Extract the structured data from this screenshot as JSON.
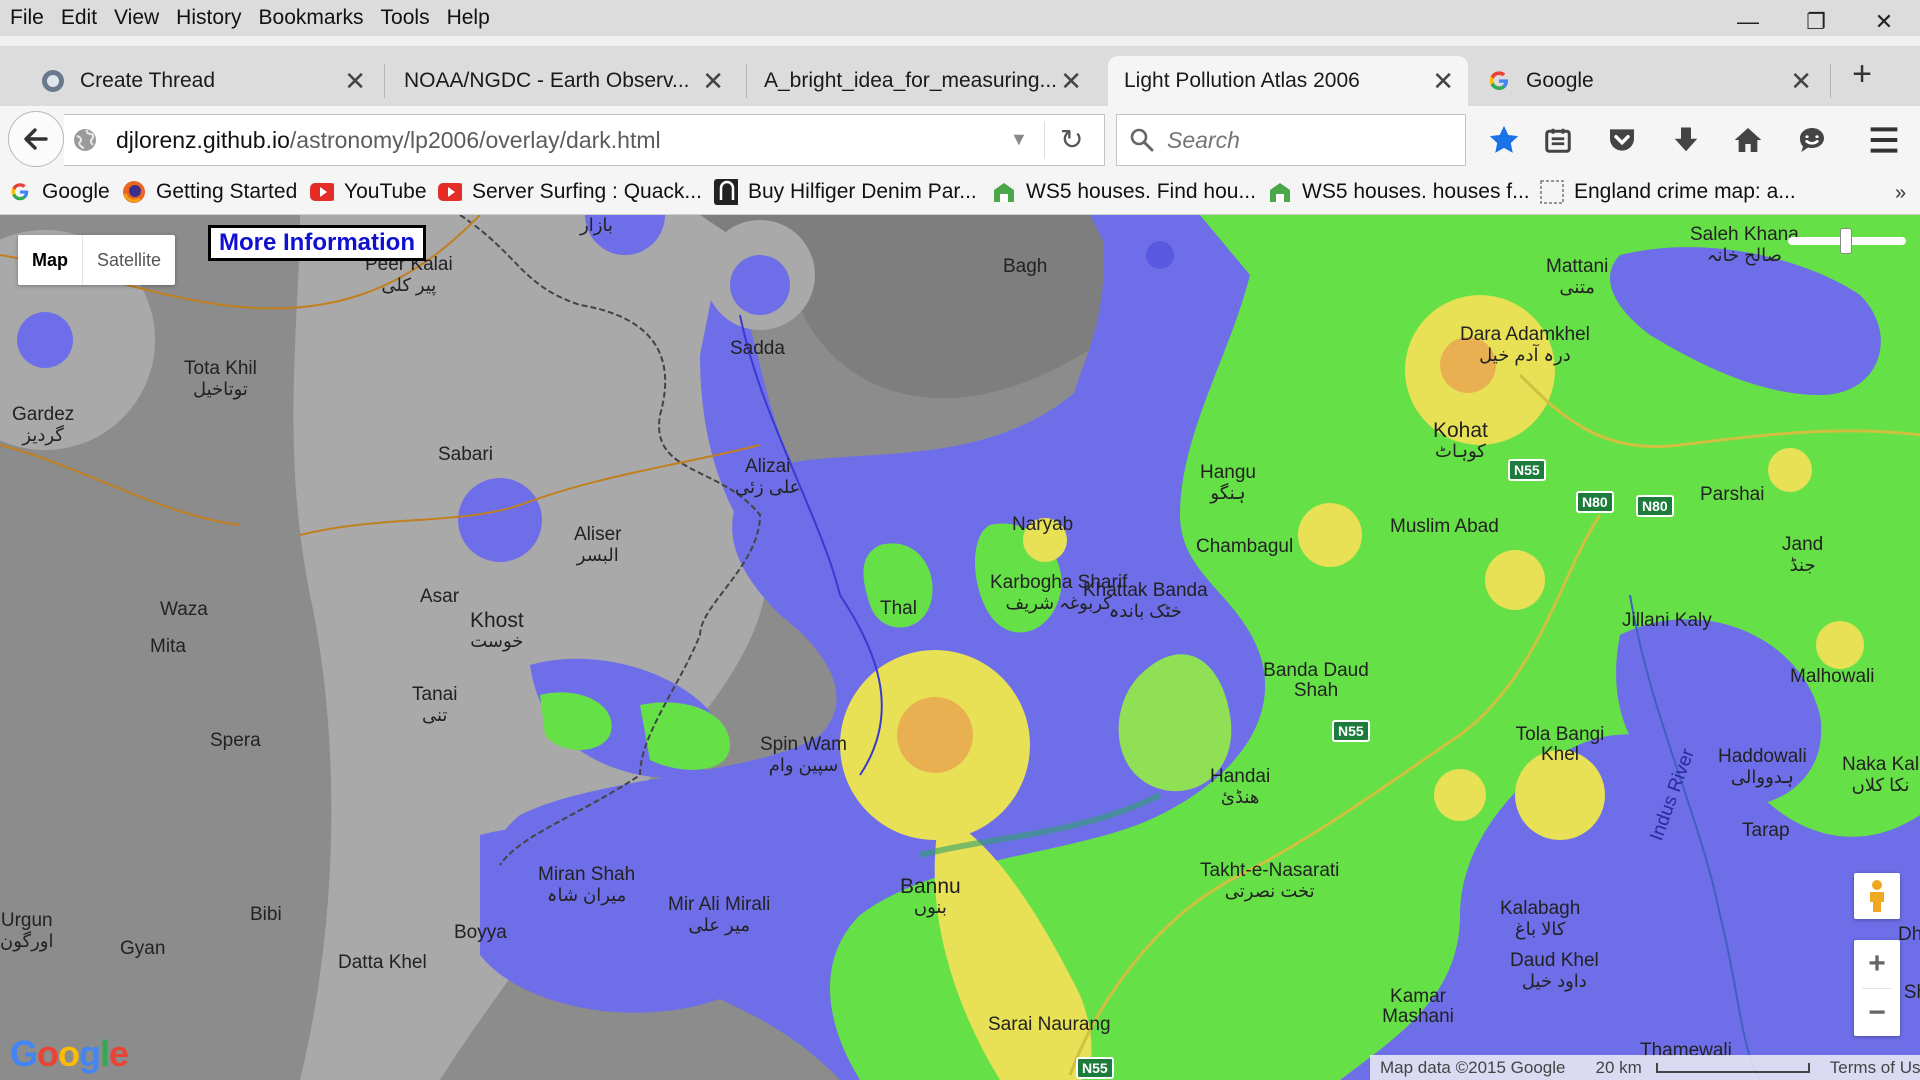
{
  "menu": [
    "File",
    "Edit",
    "View",
    "History",
    "Bookmarks",
    "Tools",
    "Help"
  ],
  "window": {
    "minimize": "—",
    "restore": "❐",
    "close": "✕"
  },
  "tabs": [
    {
      "title": "Create Thread"
    },
    {
      "title": "NOAA/NGDC - Earth Observ..."
    },
    {
      "title": "A_bright_idea_for_measuring..."
    },
    {
      "title": "Light Pollution Atlas 2006",
      "active": true
    },
    {
      "title": "Google"
    }
  ],
  "new_tab": "+",
  "nav": {
    "url_host": "djlorenz.github.io",
    "url_path": "/astronomy/lp2006/overlay/dark.html",
    "search_placeholder": "Search"
  },
  "bookmarks": [
    {
      "label": "Google"
    },
    {
      "label": "Getting Started"
    },
    {
      "label": "YouTube"
    },
    {
      "label": "Server Surfing : Quack..."
    },
    {
      "label": "Buy Hilfiger Denim Par..."
    },
    {
      "label": "WS5 houses. Find hou..."
    },
    {
      "label": "WS5 houses. houses f..."
    },
    {
      "label": "England crime map: a..."
    }
  ],
  "bookmarks_overflow": "»",
  "map": {
    "controls": {
      "map_label": "Map",
      "satellite_label": "Satellite",
      "more_info": "More Information",
      "zoom_in": "+",
      "zoom_out": "−"
    },
    "labels": [
      {
        "name": "Peer Kalai",
        "urdu": "پیر کلی"
      },
      {
        "name": "Bagh",
        "urdu": ""
      },
      {
        "name": "Sadda",
        "urdu": ""
      },
      {
        "name": "Mattani",
        "urdu": "متنی"
      },
      {
        "name": "Saleh Khana",
        "urdu": "صالح خانہ"
      },
      {
        "name": "Tota Khil",
        "urdu": "توتاخیل"
      },
      {
        "name": "Gardez",
        "urdu": "گردیز"
      },
      {
        "name": "Sabari",
        "urdu": ""
      },
      {
        "name": "Alizai",
        "urdu": "علی زئی"
      },
      {
        "name": "Dara Adamkhel",
        "urdu": "درہ آدم خیل"
      },
      {
        "name": "Kohat",
        "urdu": "کوہاٹ"
      },
      {
        "name": "Hangu",
        "urdu": "ہنگو"
      },
      {
        "name": "Parshai",
        "urdu": ""
      },
      {
        "name": "Aliser",
        "urdu": "البسر"
      },
      {
        "name": "Naryab",
        "urdu": ""
      },
      {
        "name": "Muslim Abad",
        "urdu": ""
      },
      {
        "name": "Chambagul",
        "urdu": ""
      },
      {
        "name": "Jand",
        "urdu": "جنڈ"
      },
      {
        "name": "Asar",
        "urdu": ""
      },
      {
        "name": "Khost",
        "urdu": "خوست"
      },
      {
        "name": "Karbogha Sharif",
        "urdu": "کربوغہ شریف"
      },
      {
        "name": "Khattak Banda",
        "urdu": "خٹک باندہ"
      },
      {
        "name": "Thal",
        "urdu": ""
      },
      {
        "name": "Waza",
        "urdu": ""
      },
      {
        "name": "Mita",
        "urdu": ""
      },
      {
        "name": "Jillani Kaly",
        "urdu": ""
      },
      {
        "name": "Tanai",
        "urdu": "تنی"
      },
      {
        "name": "Banda Daud Shah",
        "urdu": ""
      },
      {
        "name": "Malhowali",
        "urdu": ""
      },
      {
        "name": "Spera",
        "urdu": ""
      },
      {
        "name": "Spin Wam",
        "urdu": "سپین وام"
      },
      {
        "name": "Tola Bangi Khel",
        "urdu": ""
      },
      {
        "name": "Handai",
        "urdu": "ھنڈئ"
      },
      {
        "name": "Haddowali",
        "urdu": "ہدووالی"
      },
      {
        "name": "Naka Kal",
        "urdu": "نکا کلاں"
      },
      {
        "name": "Indus River",
        "urdu": ""
      },
      {
        "name": "Tarap",
        "urdu": ""
      },
      {
        "name": "Miran Shah",
        "urdu": "میران شاہ"
      },
      {
        "name": "Mir Ali Mirali",
        "urdu": "میر علی"
      },
      {
        "name": "Bannu",
        "urdu": "بنوں"
      },
      {
        "name": "Takht-e-Nasarati",
        "urdu": "تخت نصرتی"
      },
      {
        "name": "Kalabagh",
        "urdu": "کالا باغ"
      },
      {
        "name": "Bibi",
        "urdu": ""
      },
      {
        "name": "Boyya",
        "urdu": ""
      },
      {
        "name": "Gyan",
        "urdu": ""
      },
      {
        "name": "Datta Khel",
        "urdu": ""
      },
      {
        "name": "Daud Khel",
        "urdu": "داود خیل"
      },
      {
        "name": "Kot Sh",
        "urdu": ""
      },
      {
        "name": "Kamar Mashani",
        "urdu": ""
      },
      {
        "name": "Sarai Naurang",
        "urdu": ""
      },
      {
        "name": "Urgun",
        "urdu": "اورگون"
      },
      {
        "name": "Thamewali",
        "urdu": ""
      },
      {
        "name": "Dh",
        "urdu": ""
      },
      {
        "name": "Bazar",
        "urdu": "بازار"
      }
    ],
    "road_signs": [
      "N55",
      "N80",
      "N80",
      "N55",
      "N55"
    ],
    "attribution": {
      "map_data": "Map data ©2015 Google",
      "scale": "20 km",
      "terms": "Terms of Use"
    },
    "google_logo": "Google"
  }
}
